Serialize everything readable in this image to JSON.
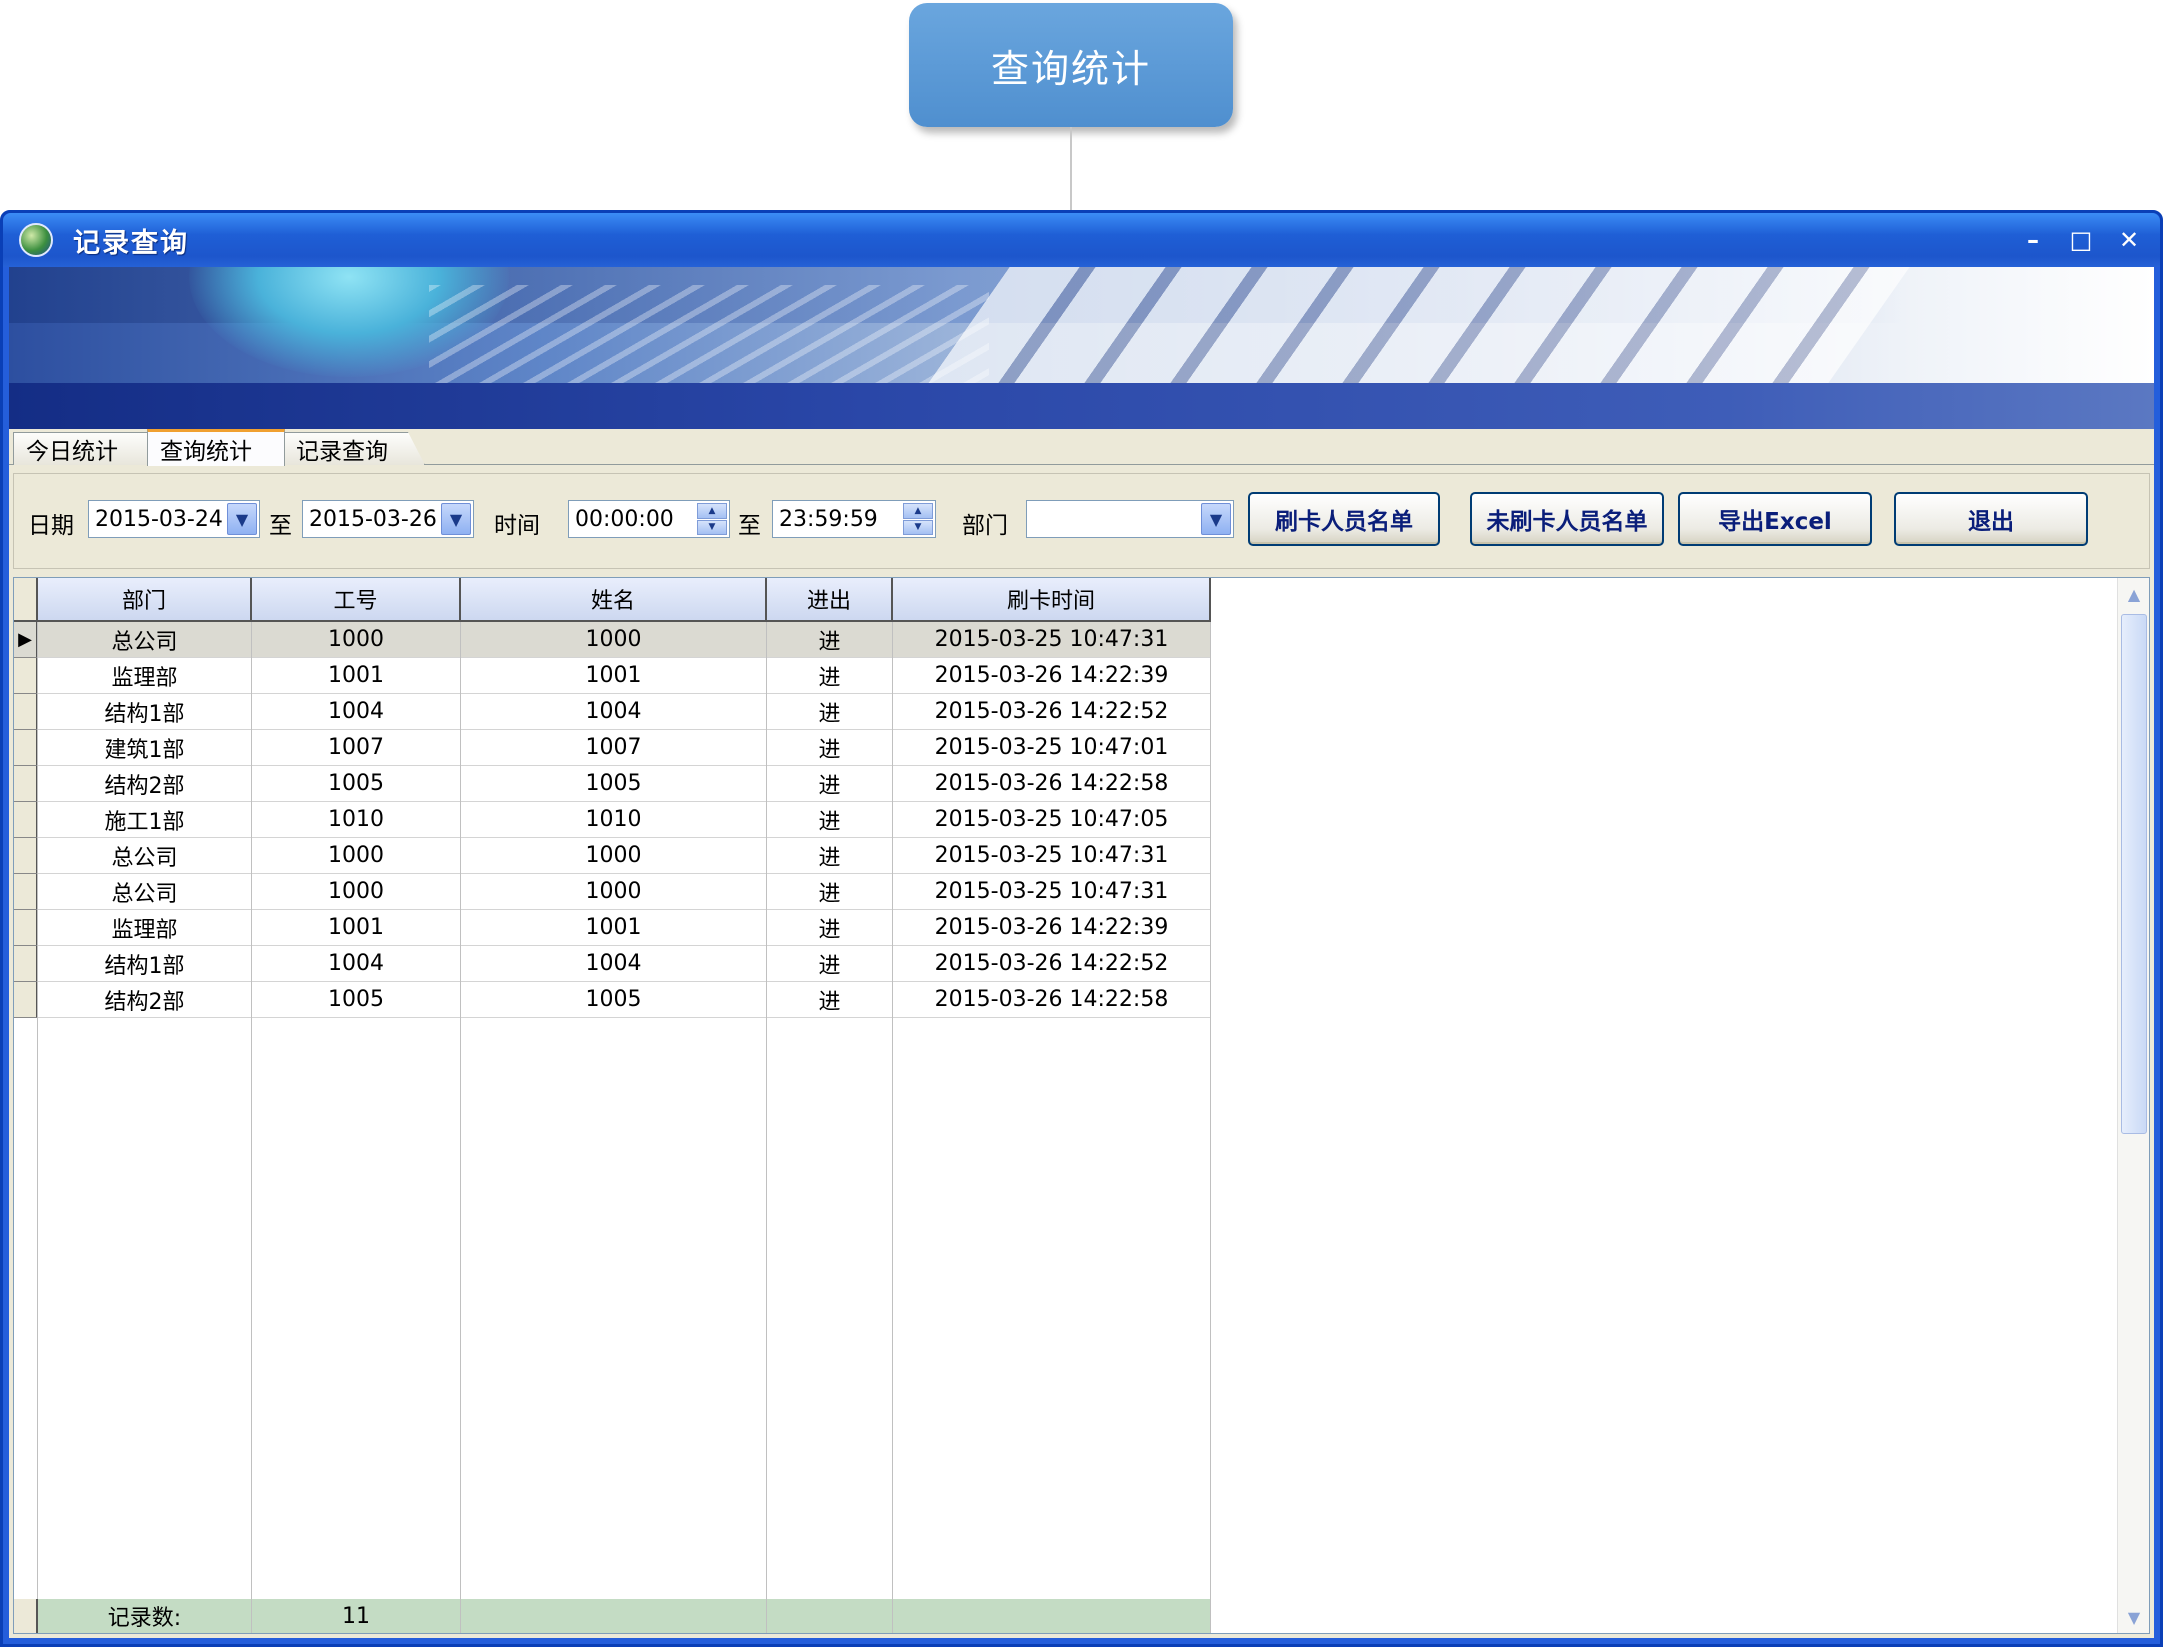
{
  "callout": {
    "label": "查询统计"
  },
  "window": {
    "title": "记录查询",
    "minimize": "–",
    "maximize": "□",
    "close": "✕"
  },
  "tabs": [
    {
      "label": "今日统计"
    },
    {
      "label": "查询统计"
    },
    {
      "label": "记录查询"
    }
  ],
  "filters": {
    "date_label": "日期",
    "date_from": "2015-03-24",
    "to_label": "至",
    "date_to": "2015-03-26",
    "time_label": "时间",
    "time_from": "00:00:00",
    "time_to": "23:59:59",
    "dept_label": "部门",
    "dept_value": "",
    "buttons": {
      "swiped": "刷卡人员名单",
      "not_swiped": "未刷卡人员名单",
      "export": "导出Excel",
      "exit": "退出"
    }
  },
  "table": {
    "columns": [
      "部门",
      "工号",
      "姓名",
      "进出",
      "刷卡时间"
    ],
    "rows": [
      [
        "总公司",
        "1000",
        "1000",
        "进",
        "2015-03-25 10:47:31"
      ],
      [
        "监理部",
        "1001",
        "1001",
        "进",
        "2015-03-26 14:22:39"
      ],
      [
        "结构1部",
        "1004",
        "1004",
        "进",
        "2015-03-26 14:22:52"
      ],
      [
        "建筑1部",
        "1007",
        "1007",
        "进",
        "2015-03-25 10:47:01"
      ],
      [
        "结构2部",
        "1005",
        "1005",
        "进",
        "2015-03-26 14:22:58"
      ],
      [
        "施工1部",
        "1010",
        "1010",
        "进",
        "2015-03-25 10:47:05"
      ],
      [
        "总公司",
        "1000",
        "1000",
        "进",
        "2015-03-25 10:47:31"
      ],
      [
        "总公司",
        "1000",
        "1000",
        "进",
        "2015-03-25 10:47:31"
      ],
      [
        "监理部",
        "1001",
        "1001",
        "进",
        "2015-03-26 14:22:39"
      ],
      [
        "结构1部",
        "1004",
        "1004",
        "进",
        "2015-03-26 14:22:52"
      ],
      [
        "结构2部",
        "1005",
        "1005",
        "进",
        "2015-03-26 14:22:58"
      ]
    ],
    "footer_label": "记录数:",
    "footer_count": "11"
  },
  "icons": {
    "app": "globe-icon",
    "dropdown": "chevron-down-icon",
    "spin": "spin-arrows-icon",
    "row_indicator": "triangle-right-icon"
  },
  "colors": {
    "titlebar": "#245edb",
    "callout": "#5b9bd5",
    "footer": "#c4dcc4",
    "selected_row": "#dbdad2"
  }
}
